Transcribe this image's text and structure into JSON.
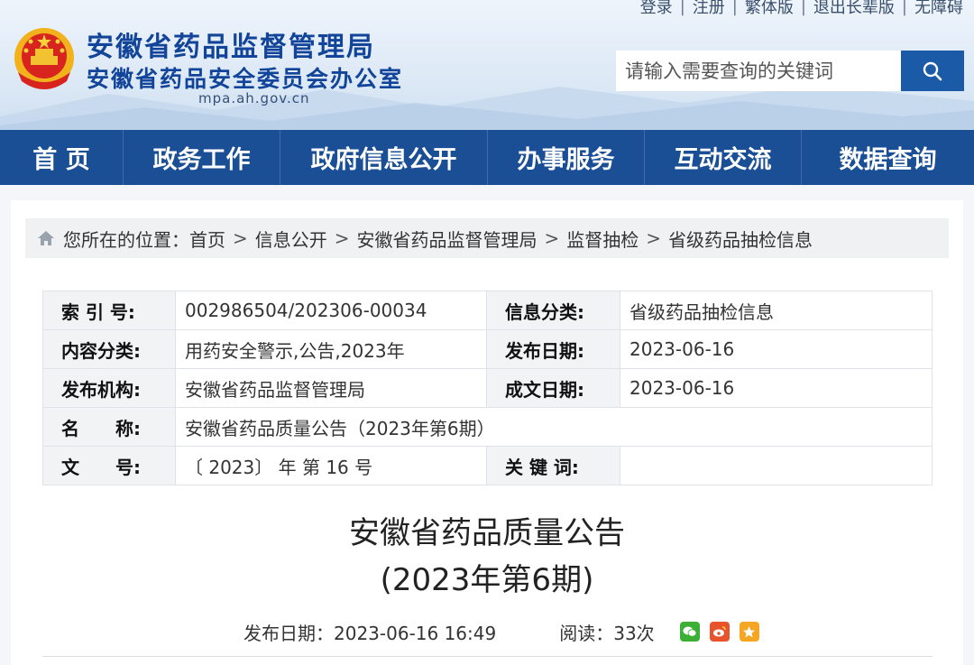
{
  "top_links": [
    "登录",
    "注册",
    "繁体版",
    "退出长辈版",
    "无障碍"
  ],
  "site": {
    "title1": "安徽省药品监督管理局",
    "title2": "安徽省药品安全委员会办公室",
    "domain": "mpa.ah.gov.cn"
  },
  "search": {
    "placeholder": "请输入需要查询的关键词",
    "button_icon": "search-icon"
  },
  "nav": [
    "首 页",
    "政务工作",
    "政府信息公开",
    "办事服务",
    "互动交流",
    "数据查询"
  ],
  "breadcrumb": {
    "prefix": "您所在的位置：",
    "items": [
      "首页",
      "信息公开",
      "安徽省药品监督管理局",
      "监督抽检",
      "省级药品抽检信息"
    ],
    "separator": ">"
  },
  "meta": {
    "index_label": "索 引 号:",
    "index_value": "002986504/202306-00034",
    "category_label": "信息分类:",
    "category_value": "省级药品抽检信息",
    "content_label": "内容分类:",
    "content_value": "用药安全警示,公告,2023年",
    "pubdate_label": "发布日期:",
    "pubdate_value": "2023-06-16",
    "org_label": "发布机构:",
    "org_value": "安徽省药品监督管理局",
    "writedate_label": "成文日期:",
    "writedate_value": "2023-06-16",
    "name_label": "名　　称:",
    "name_value": "安徽省药品质量公告（2023年第6期）",
    "docno_label": "文　　号:",
    "docno_value": "〔 2023〕 年 第 16 号",
    "keywords_label": "关 键 词:",
    "keywords_value": ""
  },
  "article": {
    "title_line1": "安徽省药品质量公告",
    "title_line2": "(2023年第6期)",
    "pubtime": "发布日期：2023-06-16 16:49",
    "reads": "阅读：33次"
  },
  "share_icons": [
    "wechat-icon",
    "weibo-icon",
    "favorite-icon"
  ],
  "colors": {
    "nav_bg": "#1a4f96",
    "title_blue": "#12459a",
    "search_btn": "#1b5aa6"
  }
}
